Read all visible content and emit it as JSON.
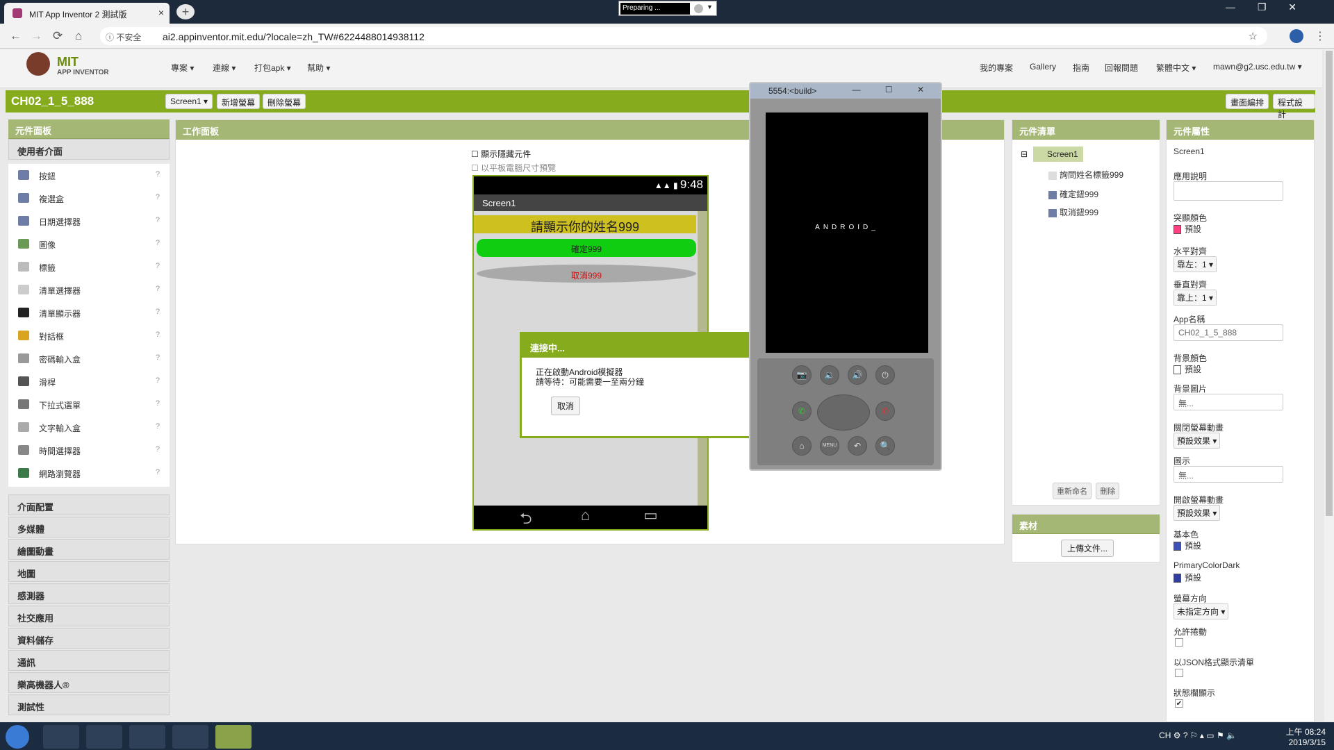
{
  "browser": {
    "tab_title": "MIT App Inventor 2 測試版",
    "tab_close": "×",
    "new_tab": "+",
    "preparing": "Preparing ...",
    "window_controls": "— ❐ ✕",
    "security": "ⓘ 不安全",
    "url": "ai2.appinventor.mit.edu/?locale=zh_TW#6224488014938112",
    "nav_back": "←",
    "nav_forward": "→",
    "nav_reload": "⟳",
    "nav_home": "⌂",
    "star": "☆",
    "menu": "⋮"
  },
  "header": {
    "logo_title": "MIT",
    "logo_sub": "APP INVENTOR",
    "menus": [
      "專案 ▾",
      "連線 ▾",
      "打包apk ▾",
      "幫助 ▾"
    ],
    "right_links": [
      "我的專案",
      "Gallery",
      "指南",
      "回報問題",
      "繁體中文 ▾",
      "mawn@g2.usc.edu.tw ▾"
    ]
  },
  "toolbar": {
    "project_name": "CH02_1_5_888",
    "screen_select": "Screen1 ▾",
    "add_screen": "新增螢幕",
    "remove_screen": "刪除螢幕",
    "designer": "畫面編排",
    "blocks": "程式設計"
  },
  "palette": {
    "title": "元件面板",
    "section": "使用者介面",
    "items": [
      "按鈕",
      "複選盒",
      "日期選擇器",
      "圖像",
      "標籤",
      "清單選擇器",
      "清單顯示器",
      "對話框",
      "密碼輸入盒",
      "滑桿",
      "下拉式選單",
      "文字輸入盒",
      "時間選擇器",
      "網路瀏覽器"
    ],
    "help": "?",
    "sections": [
      "介面配置",
      "多媒體",
      "繪圖動畫",
      "地圖",
      "感測器",
      "社交應用",
      "資料儲存",
      "通訊",
      "樂高機器人®",
      "測試性"
    ]
  },
  "viewer": {
    "title": "工作面板",
    "show_hidden": "顯示隱藏元件",
    "tablet_preview": "以平板電腦尺寸預覽",
    "time": "9:48",
    "screen_title": "Screen1",
    "label": "請顯示你的姓名999",
    "ok_button": "確定999",
    "cancel_button": "取消999",
    "nav_back": "⮌",
    "nav_home": "⌂",
    "nav_recent": "▭"
  },
  "dialog": {
    "title": "連接中...",
    "line1": "正在啟動Android模擬器",
    "line2": "請等待：可能需要一至兩分鐘",
    "cancel": "取消"
  },
  "emulator": {
    "title": "5554:<build>",
    "controls": "— ☐ ✕",
    "boot_text": "ANDROID_",
    "buttons": [
      "📷",
      "🔉",
      "🔊",
      "⏻",
      "✆",
      "✆",
      "⌂",
      "MENU",
      "↶",
      "🔍"
    ]
  },
  "components": {
    "title": "元件清單",
    "collapse": "⊟",
    "root": "Screen1",
    "children": [
      "詢問姓名標籤999",
      "確定鈕999",
      "取消鈕999"
    ],
    "rename": "重新命名",
    "delete": "刪除"
  },
  "media": {
    "title": "素材",
    "upload": "上傳文件..."
  },
  "properties": {
    "title": "元件屬性",
    "component": "Screen1",
    "about_label": "應用說明",
    "accent_label": "突顯顏色",
    "accent_value": "預設",
    "halign_label": "水平對齊",
    "halign_value": "靠左：1 ▾",
    "valign_label": "垂直對齊",
    "valign_value": "靠上：1 ▾",
    "appname_label": "App名稱",
    "appname_value": "CH02_1_5_888",
    "bg_label": "背景顏色",
    "bg_value": "預設",
    "bgimg_label": "背景圖片",
    "bgimg_value": "無...",
    "close_anim_label": "關閉螢幕動畫",
    "close_anim_value": "預設效果 ▾",
    "icon_label": "圖示",
    "icon_value": "無...",
    "open_anim_label": "開啟螢幕動畫",
    "open_anim_value": "預設效果 ▾",
    "primary_label": "基本色",
    "primary_value": "預設",
    "primary_dark_label": "PrimaryColorDark",
    "primary_dark_value": "預設",
    "orientation_label": "螢幕方向",
    "orientation_value": "未指定方向 ▾",
    "scroll_label": "允許捲動",
    "json_label": "以JSON格式顯示清單",
    "status_label": "狀態欄顯示",
    "status_check": "✔",
    "colors": {
      "accent": "#ff4081",
      "bg": "#ffffff",
      "primary": "#3f51b5",
      "primary_dark": "#303f9f"
    }
  },
  "taskbar": {
    "tray": "CH  ⚙ ? ⚐ ▴ ▭ ⚑ 🔈",
    "time": "上午 08:24",
    "date": "2019/3/15"
  }
}
